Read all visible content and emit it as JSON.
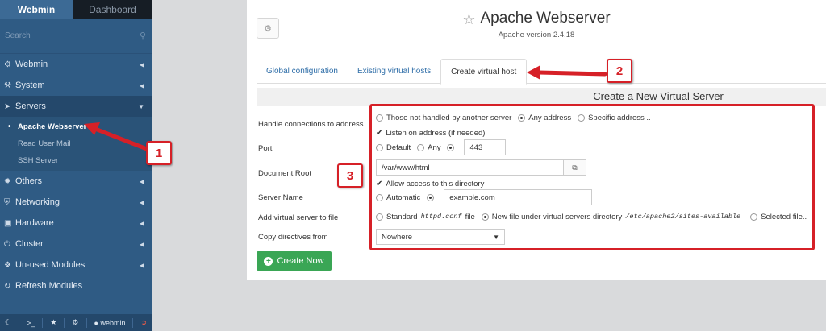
{
  "sidebar": {
    "tab_webmin": "Webmin",
    "tab_dashboard": "Dashboard",
    "search_placeholder": "Search",
    "menu": [
      {
        "label": "Webmin"
      },
      {
        "label": "System"
      },
      {
        "label": "Servers"
      },
      {
        "label": "Others"
      },
      {
        "label": "Networking"
      },
      {
        "label": "Hardware"
      },
      {
        "label": "Cluster"
      },
      {
        "label": "Un-used Modules"
      },
      {
        "label": "Refresh Modules"
      }
    ],
    "servers_sub": [
      "Apache Webserver",
      "Read User Mail",
      "SSH Server"
    ],
    "user": "webmin"
  },
  "header": {
    "title": "Apache Webserver",
    "subtitle": "Apache version 2.4.18"
  },
  "tabs": [
    "Global configuration",
    "Existing virtual hosts",
    "Create virtual host"
  ],
  "form": {
    "heading": "Create a New Virtual Server",
    "labels": {
      "handle": "Handle connections to address",
      "port": "Port",
      "docroot": "Document Root",
      "servername": "Server Name",
      "addfile": "Add virtual server to file",
      "copy": "Copy directives from"
    },
    "handle_opts": [
      "Those not handled by another server",
      "Any address",
      "Specific address .."
    ],
    "listen": "Listen on address (if needed)",
    "port_opts": [
      "Default",
      "Any"
    ],
    "port_value": "443",
    "docroot_value": "/var/www/html",
    "allow_access": "Allow access to this directory",
    "servername_auto": "Automatic",
    "servername_value": "example.com",
    "addfile": {
      "standard": "Standard",
      "standard_code": "httpd.conf",
      "standard_suffix": "file",
      "newfile": "New file under virtual servers directory",
      "newfile_path": "/etc/apache2/sites-available",
      "selected": "Selected file.."
    },
    "copy_value": "Nowhere",
    "submit": "Create Now"
  },
  "annotations": [
    "1",
    "2",
    "3"
  ],
  "colors": {
    "sidebar": "#2f5b84",
    "accent_red": "#d62027",
    "button_green": "#3aa655"
  }
}
